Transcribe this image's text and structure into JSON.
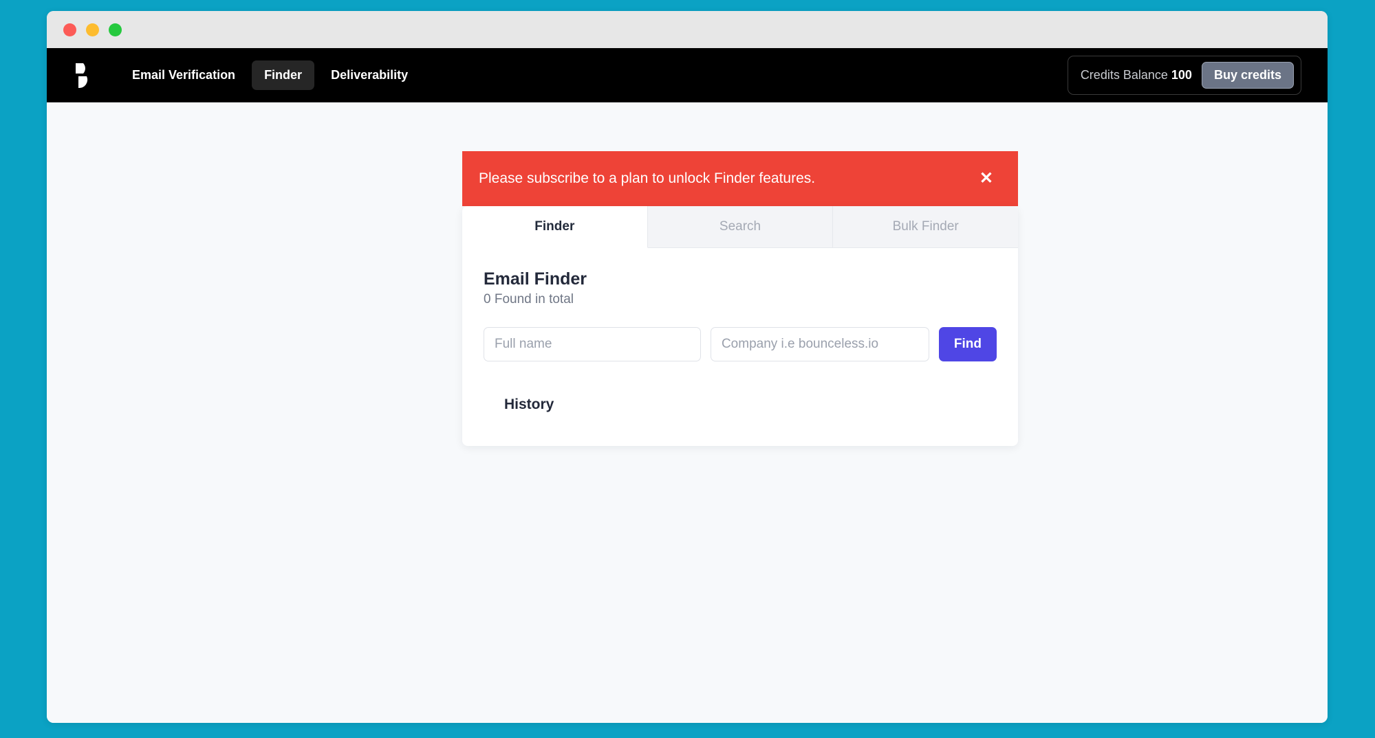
{
  "window": {
    "traffic_lights": [
      {
        "name": "close",
        "color": "#fc5b57"
      },
      {
        "name": "minimize",
        "color": "#fdbc2f"
      },
      {
        "name": "maximize",
        "color": "#26c93f"
      }
    ],
    "background_color": "#0ba2c4",
    "page_background": "#f7f9fb"
  },
  "navbar": {
    "logo_icon": "bounceless-b-logo-icon",
    "links": [
      {
        "label": "Email Verification",
        "active": false
      },
      {
        "label": "Finder",
        "active": true
      },
      {
        "label": "Deliverability",
        "active": false
      }
    ],
    "credits": {
      "label": "Credits Balance",
      "value": "100",
      "buy_button": "Buy credits"
    },
    "background_color": "#000000",
    "active_pill_color": "#262626"
  },
  "alert": {
    "message": "Please subscribe to a plan to unlock Finder features.",
    "close_icon": "✕",
    "color": "#ee4337"
  },
  "card": {
    "tabs": [
      {
        "label": "Finder",
        "active": true
      },
      {
        "label": "Search",
        "active": false
      },
      {
        "label": "Bulk Finder",
        "active": false
      }
    ],
    "finder": {
      "title": "Email Finder",
      "subtitle": "0 Found in total",
      "inputs": {
        "full_name": {
          "value": "",
          "placeholder": "Full name"
        },
        "company": {
          "value": "",
          "placeholder": "Company i.e bounceless.io"
        }
      },
      "find_button": "Find",
      "find_button_color": "#4f46e5",
      "history_title": "History"
    }
  }
}
